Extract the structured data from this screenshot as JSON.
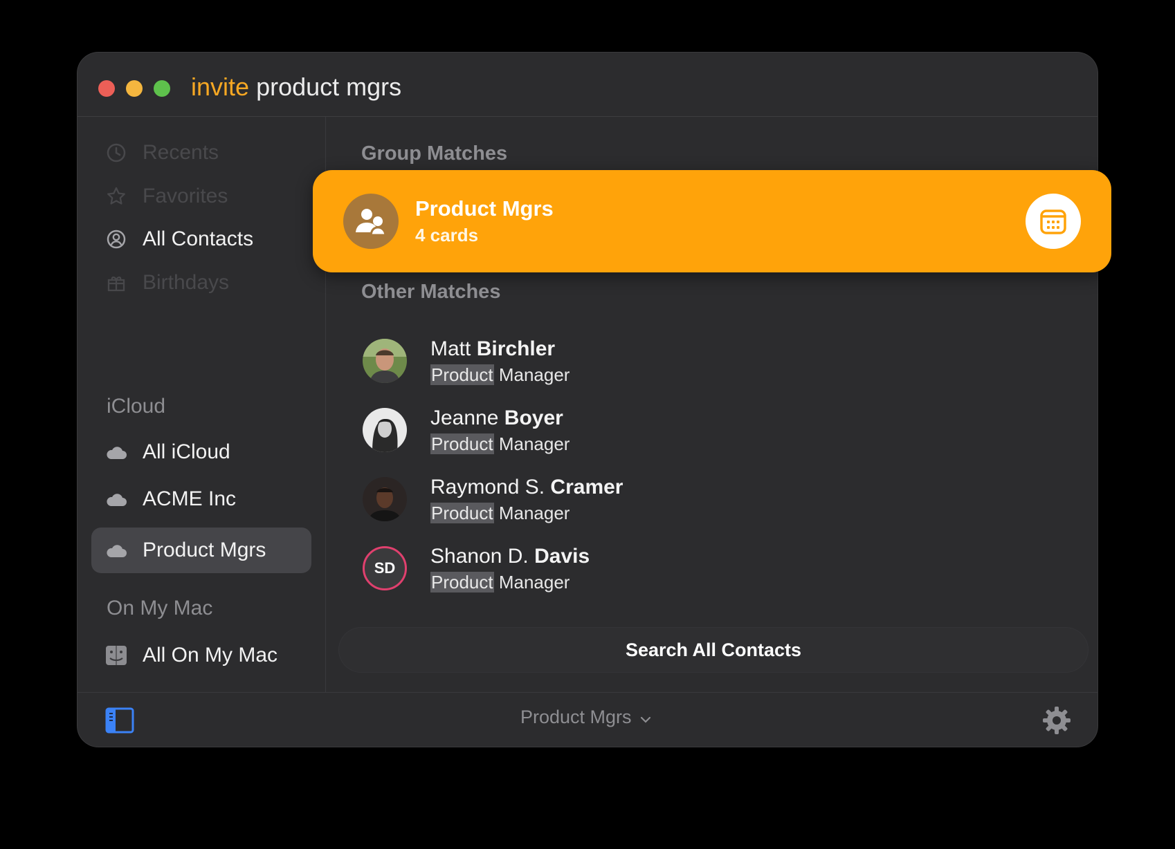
{
  "window": {
    "query_command": "invite",
    "query_text": "product mgrs"
  },
  "sidebar": {
    "items": [
      {
        "label": "Recents",
        "icon": "clock-icon",
        "dimmed": true
      },
      {
        "label": "Favorites",
        "icon": "star-icon",
        "dimmed": true
      },
      {
        "label": "All Contacts",
        "icon": "person-circle-icon",
        "dimmed": false
      },
      {
        "label": "Birthdays",
        "icon": "gift-icon",
        "dimmed": true
      }
    ],
    "icloud_header": "iCloud",
    "icloud_items": [
      {
        "label": "All iCloud",
        "icon": "cloud-icon"
      },
      {
        "label": "ACME Inc",
        "icon": "cloud-icon"
      },
      {
        "label": "Product Mgrs",
        "icon": "cloud-icon",
        "selected": true
      }
    ],
    "mac_header": "On My Mac",
    "mac_items": [
      {
        "label": "All On My Mac",
        "icon": "finder-icon"
      }
    ]
  },
  "results": {
    "group_header": "Group Matches",
    "group": {
      "name": "Product Mgrs",
      "count": "4 cards",
      "action_icon": "calendar-icon"
    },
    "other_header": "Other Matches",
    "contacts": [
      {
        "first": "Matt",
        "last": "Birchler",
        "role_match": "Product",
        "role_rest": "Manager"
      },
      {
        "first": "Jeanne",
        "last": "Boyer",
        "role_match": "Product",
        "role_rest": "Manager"
      },
      {
        "first": "Raymond S.",
        "last": "Cramer",
        "role_match": "Product",
        "role_rest": "Manager"
      },
      {
        "first": "Shanon D.",
        "last": "Davis",
        "role_match": "Product",
        "role_rest": "Manager",
        "initials": "SD"
      }
    ],
    "search_all_label": "Search All Contacts"
  },
  "footer": {
    "scope_label": "Product Mgrs"
  },
  "colors": {
    "accent": "#ffa30a",
    "window_bg": "#2c2c2e",
    "selected_bg": "#454549"
  }
}
